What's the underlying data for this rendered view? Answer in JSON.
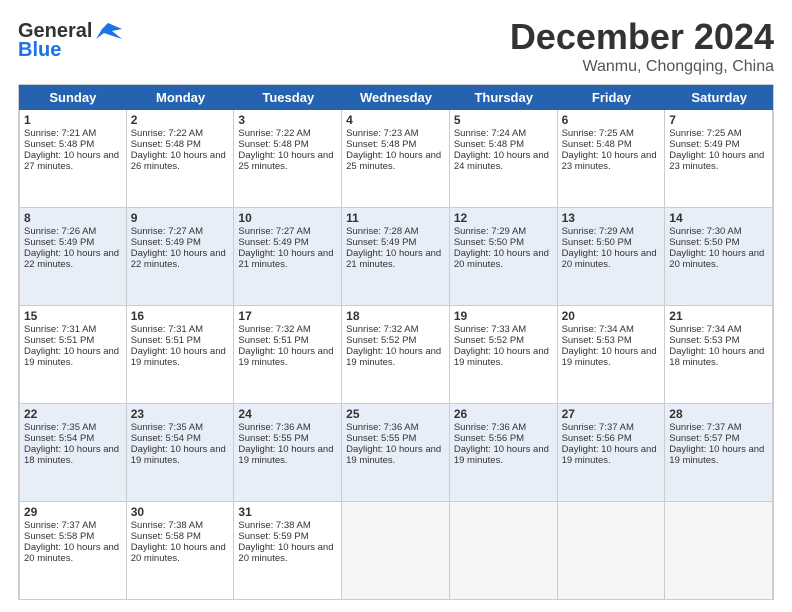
{
  "logo": {
    "line1": "General",
    "line2": "Blue"
  },
  "title": "December 2024",
  "location": "Wanmu, Chongqing, China",
  "days_of_week": [
    "Sunday",
    "Monday",
    "Tuesday",
    "Wednesday",
    "Thursday",
    "Friday",
    "Saturday"
  ],
  "weeks": [
    [
      {
        "day": "1",
        "sunrise": "Sunrise: 7:21 AM",
        "sunset": "Sunset: 5:48 PM",
        "daylight": "Daylight: 10 hours and 27 minutes."
      },
      {
        "day": "2",
        "sunrise": "Sunrise: 7:22 AM",
        "sunset": "Sunset: 5:48 PM",
        "daylight": "Daylight: 10 hours and 26 minutes."
      },
      {
        "day": "3",
        "sunrise": "Sunrise: 7:22 AM",
        "sunset": "Sunset: 5:48 PM",
        "daylight": "Daylight: 10 hours and 25 minutes."
      },
      {
        "day": "4",
        "sunrise": "Sunrise: 7:23 AM",
        "sunset": "Sunset: 5:48 PM",
        "daylight": "Daylight: 10 hours and 25 minutes."
      },
      {
        "day": "5",
        "sunrise": "Sunrise: 7:24 AM",
        "sunset": "Sunset: 5:48 PM",
        "daylight": "Daylight: 10 hours and 24 minutes."
      },
      {
        "day": "6",
        "sunrise": "Sunrise: 7:25 AM",
        "sunset": "Sunset: 5:48 PM",
        "daylight": "Daylight: 10 hours and 23 minutes."
      },
      {
        "day": "7",
        "sunrise": "Sunrise: 7:25 AM",
        "sunset": "Sunset: 5:49 PM",
        "daylight": "Daylight: 10 hours and 23 minutes."
      }
    ],
    [
      {
        "day": "8",
        "sunrise": "Sunrise: 7:26 AM",
        "sunset": "Sunset: 5:49 PM",
        "daylight": "Daylight: 10 hours and 22 minutes."
      },
      {
        "day": "9",
        "sunrise": "Sunrise: 7:27 AM",
        "sunset": "Sunset: 5:49 PM",
        "daylight": "Daylight: 10 hours and 22 minutes."
      },
      {
        "day": "10",
        "sunrise": "Sunrise: 7:27 AM",
        "sunset": "Sunset: 5:49 PM",
        "daylight": "Daylight: 10 hours and 21 minutes."
      },
      {
        "day": "11",
        "sunrise": "Sunrise: 7:28 AM",
        "sunset": "Sunset: 5:49 PM",
        "daylight": "Daylight: 10 hours and 21 minutes."
      },
      {
        "day": "12",
        "sunrise": "Sunrise: 7:29 AM",
        "sunset": "Sunset: 5:50 PM",
        "daylight": "Daylight: 10 hours and 20 minutes."
      },
      {
        "day": "13",
        "sunrise": "Sunrise: 7:29 AM",
        "sunset": "Sunset: 5:50 PM",
        "daylight": "Daylight: 10 hours and 20 minutes."
      },
      {
        "day": "14",
        "sunrise": "Sunrise: 7:30 AM",
        "sunset": "Sunset: 5:50 PM",
        "daylight": "Daylight: 10 hours and 20 minutes."
      }
    ],
    [
      {
        "day": "15",
        "sunrise": "Sunrise: 7:31 AM",
        "sunset": "Sunset: 5:51 PM",
        "daylight": "Daylight: 10 hours and 19 minutes."
      },
      {
        "day": "16",
        "sunrise": "Sunrise: 7:31 AM",
        "sunset": "Sunset: 5:51 PM",
        "daylight": "Daylight: 10 hours and 19 minutes."
      },
      {
        "day": "17",
        "sunrise": "Sunrise: 7:32 AM",
        "sunset": "Sunset: 5:51 PM",
        "daylight": "Daylight: 10 hours and 19 minutes."
      },
      {
        "day": "18",
        "sunrise": "Sunrise: 7:32 AM",
        "sunset": "Sunset: 5:52 PM",
        "daylight": "Daylight: 10 hours and 19 minutes."
      },
      {
        "day": "19",
        "sunrise": "Sunrise: 7:33 AM",
        "sunset": "Sunset: 5:52 PM",
        "daylight": "Daylight: 10 hours and 19 minutes."
      },
      {
        "day": "20",
        "sunrise": "Sunrise: 7:34 AM",
        "sunset": "Sunset: 5:53 PM",
        "daylight": "Daylight: 10 hours and 19 minutes."
      },
      {
        "day": "21",
        "sunrise": "Sunrise: 7:34 AM",
        "sunset": "Sunset: 5:53 PM",
        "daylight": "Daylight: 10 hours and 18 minutes."
      }
    ],
    [
      {
        "day": "22",
        "sunrise": "Sunrise: 7:35 AM",
        "sunset": "Sunset: 5:54 PM",
        "daylight": "Daylight: 10 hours and 18 minutes."
      },
      {
        "day": "23",
        "sunrise": "Sunrise: 7:35 AM",
        "sunset": "Sunset: 5:54 PM",
        "daylight": "Daylight: 10 hours and 19 minutes."
      },
      {
        "day": "24",
        "sunrise": "Sunrise: 7:36 AM",
        "sunset": "Sunset: 5:55 PM",
        "daylight": "Daylight: 10 hours and 19 minutes."
      },
      {
        "day": "25",
        "sunrise": "Sunrise: 7:36 AM",
        "sunset": "Sunset: 5:55 PM",
        "daylight": "Daylight: 10 hours and 19 minutes."
      },
      {
        "day": "26",
        "sunrise": "Sunrise: 7:36 AM",
        "sunset": "Sunset: 5:56 PM",
        "daylight": "Daylight: 10 hours and 19 minutes."
      },
      {
        "day": "27",
        "sunrise": "Sunrise: 7:37 AM",
        "sunset": "Sunset: 5:56 PM",
        "daylight": "Daylight: 10 hours and 19 minutes."
      },
      {
        "day": "28",
        "sunrise": "Sunrise: 7:37 AM",
        "sunset": "Sunset: 5:57 PM",
        "daylight": "Daylight: 10 hours and 19 minutes."
      }
    ],
    [
      {
        "day": "29",
        "sunrise": "Sunrise: 7:37 AM",
        "sunset": "Sunset: 5:58 PM",
        "daylight": "Daylight: 10 hours and 20 minutes."
      },
      {
        "day": "30",
        "sunrise": "Sunrise: 7:38 AM",
        "sunset": "Sunset: 5:58 PM",
        "daylight": "Daylight: 10 hours and 20 minutes."
      },
      {
        "day": "31",
        "sunrise": "Sunrise: 7:38 AM",
        "sunset": "Sunset: 5:59 PM",
        "daylight": "Daylight: 10 hours and 20 minutes."
      },
      null,
      null,
      null,
      null
    ]
  ]
}
